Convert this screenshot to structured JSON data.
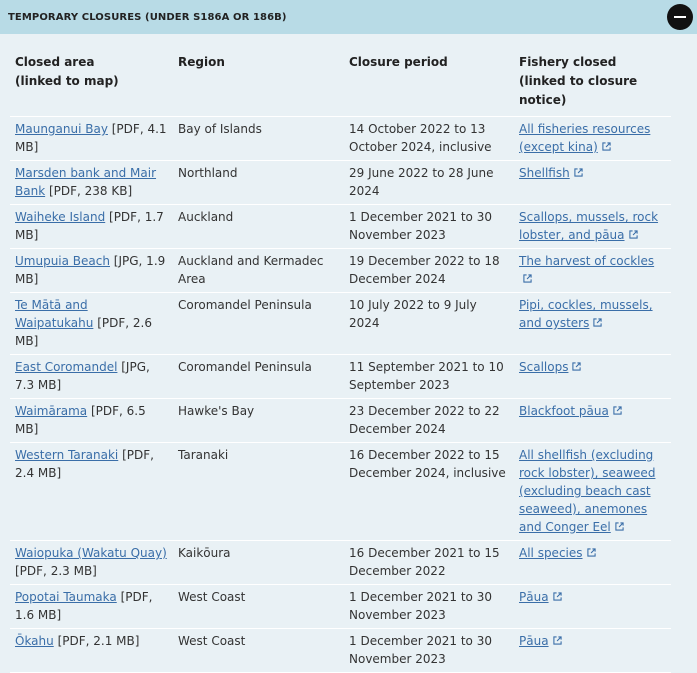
{
  "header": {
    "title": "TEMPORARY CLOSURES (UNDER S186A OR 186B)"
  },
  "columns": {
    "area": [
      "Closed area",
      "(linked to map)"
    ],
    "region": "Region",
    "period": "Closure period",
    "fishery": [
      "Fishery closed",
      "(linked to closure notice)"
    ]
  },
  "rows": [
    {
      "area_link": "Maunganui Bay",
      "area_file": " [PDF, 4.1 MB]",
      "region": "Bay of Islands",
      "period": "14 October 2022 to 13 October 2024, inclusive",
      "fishery": "All fisheries resources (except kina)"
    },
    {
      "area_link": "Marsden bank and Mair Bank",
      "area_file": " [PDF, 238 KB]",
      "region": "Northland",
      "period": "29 June 2022 to 28 June 2024",
      "fishery": "Shellfish"
    },
    {
      "area_link": "Waiheke Island",
      "area_file": " [PDF, 1.7 MB]",
      "region": "Auckland",
      "period": "1 December 2021 to 30 November 2023",
      "fishery": "Scallops, mussels, rock lobster, and pāua"
    },
    {
      "area_link": "Umupuia Beach",
      "area_file": " [JPG, 1.9 MB]",
      "region": "Auckland and Kermadec Area",
      "period": "19 December 2022 to 18 December 2024",
      "fishery": "The harvest of cockles"
    },
    {
      "area_link": "Te Mātā and Waipatukahu",
      "area_file": " [PDF, 2.6 MB]",
      "region": "Coromandel Peninsula",
      "period": "10 July 2022 to 9 July 2024",
      "fishery": "Pipi, cockles, mussels, and oysters"
    },
    {
      "area_link": "East Coromandel",
      "area_file": " [JPG, 7.3 MB]",
      "region": "Coromandel Peninsula",
      "period": "11 September 2021 to 10 September 2023",
      "fishery": "Scallops"
    },
    {
      "area_link": "Waimārama",
      "area_file": " [PDF, 6.5 MB]",
      "region": "Hawke's Bay",
      "period": "23 December 2022 to 22 December 2024",
      "fishery": "Blackfoot pāua"
    },
    {
      "area_link": "Western Taranaki",
      "area_file": " [PDF, 2.4 MB]",
      "region": "Taranaki",
      "period": "16 December 2022 to 15 December 2024, inclusive",
      "fishery": "All shellfish (excluding rock lobster), seaweed (excluding beach cast seaweed), anemones and Conger Eel"
    },
    {
      "area_link": "Waiopuka (Wakatu Quay)",
      "area_file": " [PDF, 2.3 MB]",
      "region": "Kaikōura",
      "period": "16 December 2021 to 15 December 2022",
      "fishery": "All species"
    },
    {
      "area_link": "Popotai Taumaka",
      "area_file": " [PDF, 1.6 MB]",
      "region": "West Coast",
      "period": "1 December 2021 to 30 November 2023",
      "fishery": "Pāua"
    },
    {
      "area_link": "Ōkahu",
      "area_file": " [PDF, 2.1 MB]",
      "region": "West Coast",
      "period": "1 December 2021 to 30 November 2023",
      "fishery": "Pāua"
    }
  ],
  "colors": {
    "header_bg": "#b8dbe6",
    "table_bg": "#e9f1f5",
    "link": "#3a6ea8"
  },
  "icons": {
    "collapse": "minus-circle-icon",
    "external": "external-link-icon"
  }
}
